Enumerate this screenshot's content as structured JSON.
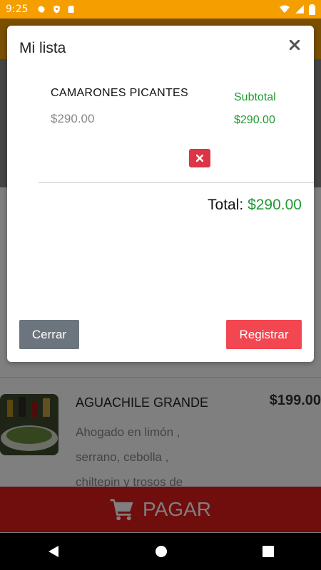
{
  "status_bar": {
    "time": "9:25",
    "left_icons": [
      "gear-icon",
      "shield-icon",
      "sd-card-icon"
    ],
    "right_icons": [
      "wifi-icon",
      "signal-icon",
      "battery-icon"
    ]
  },
  "background": {
    "product": {
      "name": "AGUACHILE GRANDE",
      "price": "$199.00",
      "description_lines": [
        "Ahogado en limón ,",
        "serrano, cebolla ,",
        "chiltepin y trosos de"
      ]
    },
    "pay_bar": {
      "label": "PAGAR",
      "icon": "cart-icon"
    }
  },
  "modal": {
    "title": "Mi lista",
    "close_icon": "close-icon",
    "items": [
      {
        "name": "CAMARONES PICANTES",
        "price": "$290.00",
        "subtotal_label": "Subtotal",
        "subtotal": "$290.00",
        "remove_icon": "remove-icon"
      }
    ],
    "total_label": "Total:",
    "total_value": "$290.00",
    "close_button": "Cerrar",
    "register_button": "Registrar"
  },
  "colors": {
    "app_bar": "#f59e00",
    "pay_bar": "#e01b1b",
    "subtotal_green": "#1e9b32",
    "remove_red": "#dc3545",
    "register_red": "#f24650",
    "close_gray": "#6c757d"
  },
  "nav_bar": {
    "icons": [
      "back-icon",
      "home-icon",
      "recents-icon"
    ]
  }
}
